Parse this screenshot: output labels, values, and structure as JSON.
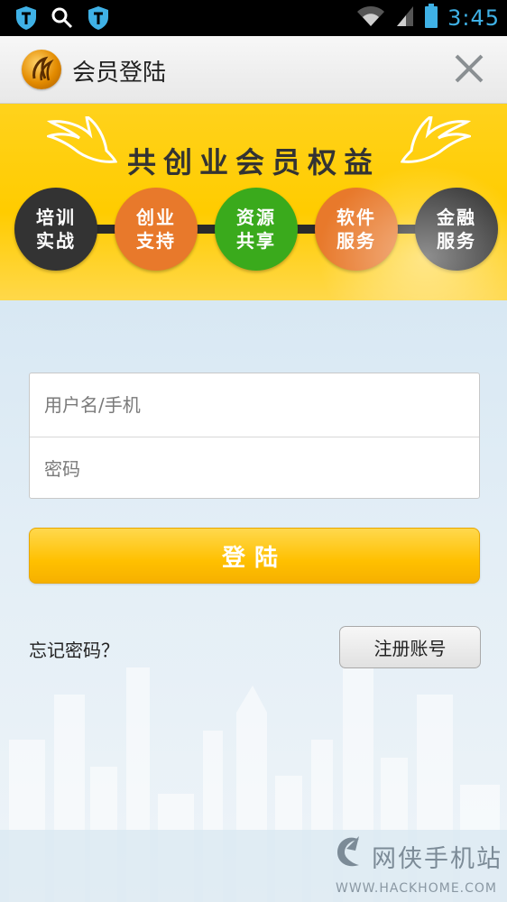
{
  "status_bar": {
    "time": "3:45",
    "left_icons": [
      "shield-icon",
      "search-icon",
      "shield-icon"
    ],
    "right_icons": [
      "wifi-icon",
      "signal-icon",
      "battery-icon"
    ],
    "accent": "#3fb1e6"
  },
  "header": {
    "title": "会员登陆",
    "close_label": "close"
  },
  "banner": {
    "title": "共创业会员权益",
    "benefits": [
      {
        "label": "培训\n实战",
        "color": "#333333"
      },
      {
        "label": "创业\n支持",
        "color": "#e8792b"
      },
      {
        "label": "资源\n共享",
        "color": "#3aaa1c"
      },
      {
        "label": "软件\n服务",
        "color": "#e8792b"
      },
      {
        "label": "金融\n服务",
        "color": "#333333"
      }
    ]
  },
  "form": {
    "username_placeholder": "用户名/手机",
    "password_placeholder": "密码",
    "login_label": "登陆",
    "forgot_label": "忘记密码？",
    "register_label": "注册账号"
  },
  "watermark": {
    "name": "网侠手机站",
    "url": "WWW.HACKHOME.COM"
  }
}
